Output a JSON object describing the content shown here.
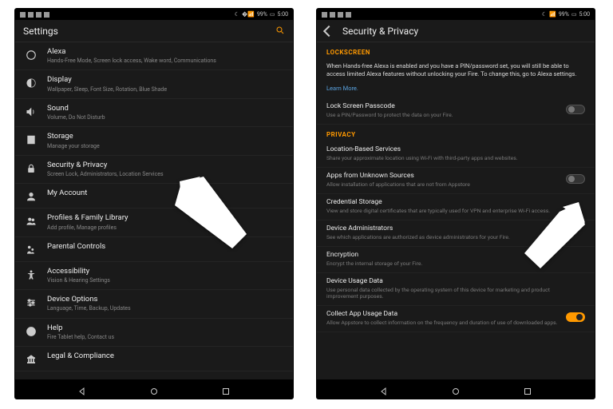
{
  "status": {
    "battery": "99%",
    "time": "5:00"
  },
  "left": {
    "header_title": "Settings",
    "items": [
      {
        "title": "Alexa",
        "sub": "Hands-Free Mode, Screen lock access, Wake word, Communications"
      },
      {
        "title": "Display",
        "sub": "Wallpaper, Sleep, Font Size, Rotation, Blue Shade"
      },
      {
        "title": "Sound",
        "sub": "Volume, Do Not Disturb"
      },
      {
        "title": "Storage",
        "sub": "Manage your storage"
      },
      {
        "title": "Security & Privacy",
        "sub": "Screen Lock, Administrators, Location Services"
      },
      {
        "title": "My Account",
        "sub": ""
      },
      {
        "title": "Profiles & Family Library",
        "sub": "Add profile, Manage profiles"
      },
      {
        "title": "Parental Controls",
        "sub": ""
      },
      {
        "title": "Accessibility",
        "sub": "Vision & Hearing Settings"
      },
      {
        "title": "Device Options",
        "sub": "Language, Time, Backup, Updates"
      },
      {
        "title": "Help",
        "sub": "Fire Tablet help, Contact us"
      },
      {
        "title": "Legal & Compliance",
        "sub": ""
      }
    ]
  },
  "right": {
    "header_title": "Security & Privacy",
    "section_lockscreen": "LOCKSCREEN",
    "alexa_info": "When Hands-free Alexa is enabled and you have a PIN/password set, you will still be able to access limited Alexa features without unlocking your Fire. To change this, go to Alexa settings.",
    "learn_more": "Learn More.",
    "lock_passcode": {
      "title": "Lock Screen Passcode",
      "sub": "Use a PIN/Password to protect the data on your Fire."
    },
    "section_privacy": "PRIVACY",
    "items": [
      {
        "title": "Location-Based Services",
        "sub": "Share your approximate location using Wi-Fi with third-party apps and websites."
      },
      {
        "title": "Apps from Unknown Sources",
        "sub": "Allow installation of applications that are not from Appstore"
      },
      {
        "title": "Credential Storage",
        "sub": "View and store digital certificates that are typically used for VPN and enterprise Wi-Fi access."
      },
      {
        "title": "Device Administrators",
        "sub": "See which applications are authorized as device administrators for your Fire."
      },
      {
        "title": "Encryption",
        "sub": "Encrypt the internal storage of your Fire."
      },
      {
        "title": "Device Usage Data",
        "sub": "Use personal data collected by the operating system of this device for marketing and product improvement purposes."
      },
      {
        "title": "Collect App Usage Data",
        "sub": "Allow Appstore to collect information on the frequency and duration of use of downloaded apps."
      }
    ]
  }
}
